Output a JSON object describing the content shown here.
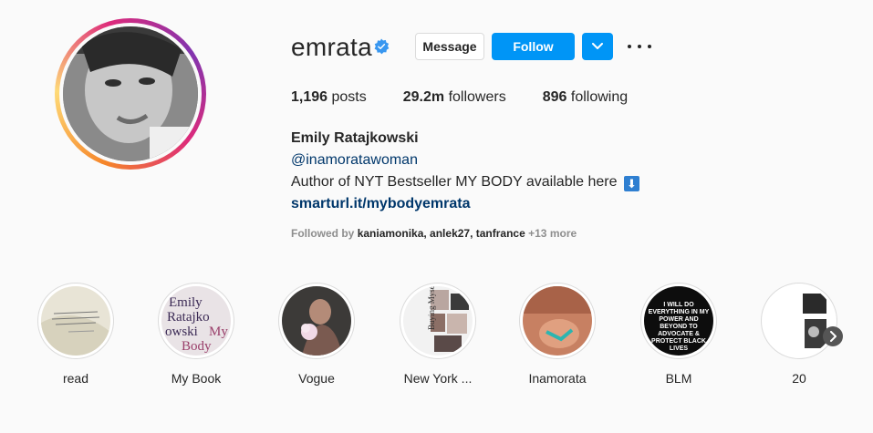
{
  "profile": {
    "username": "emrata",
    "verified_icon": "verified-badge-icon",
    "buttons": {
      "message": "Message",
      "follow": "Follow",
      "dropdown_icon": "chevron-down-icon",
      "more_icon": "more-options-icon"
    },
    "stats": {
      "posts_count": "1,196",
      "posts_label": "posts",
      "followers_count": "29.2m",
      "followers_label": "followers",
      "following_count": "896",
      "following_label": "following"
    },
    "full_name": "Emily Ratajkowski",
    "handle": "@inamoratawoman",
    "bio": "Author of NYT Bestseller MY BODY available here",
    "bio_emoji": "⬇",
    "link": "smarturl.it/mybodyemrata",
    "followed_by_prefix": "Followed by",
    "followed_by_names": "kaniamonika, anlek27, tanfrance",
    "followed_by_more": "+13 more"
  },
  "highlights": [
    {
      "label": "read"
    },
    {
      "label": "My Book",
      "cover_text": "Emily Ratajkowski My Body"
    },
    {
      "label": "Vogue"
    },
    {
      "label": "New York ...",
      "cover_text": "Buying Myself Back"
    },
    {
      "label": "Inamorata"
    },
    {
      "label": "BLM",
      "cover_text": "I WILL DO EVERYTHING IN MY POWER AND BEYOND TO ADVOCATE & PROTECT BLACK LIVES I CHALL"
    },
    {
      "label": "20"
    }
  ],
  "highlights_next_icon": "chevron-right-icon",
  "colors": {
    "accent": "#0095f6",
    "link": "#00376b",
    "muted": "#8e8e8e"
  }
}
